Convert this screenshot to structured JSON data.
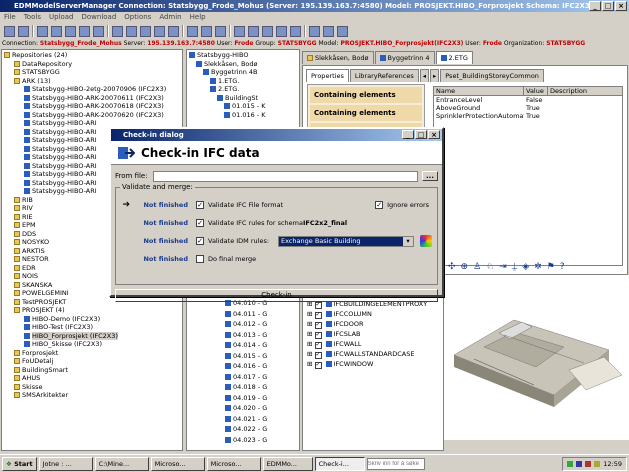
{
  "app": {
    "title": "EDMModelServerManager  Connection: Statsbygg_Frode_Mohus  (Server: 195.139.163.7:4580)  Model: PROSJEKT.HIBO_Forprosjekt  Schema: IFC2X3"
  },
  "menu": [
    "File",
    "Tools",
    "Upload",
    "Download",
    "Options",
    "Admin",
    "Help"
  ],
  "infobar": {
    "connection_label": "Connection:",
    "connection": "Statsbygg_Frode_Mohus",
    "server_label": "Server:",
    "server": "195.139.163.7:4580",
    "user_label": "User:",
    "user": "Frode",
    "group_label": "Group:",
    "group": "STATSBYGG",
    "model_label": "Model:",
    "model": "PROSJEKT.HIBO_Forprosjekt(IFC2X3)",
    "user2_label": "User:",
    "user2": "Frode",
    "org_label": "Organization:",
    "org": "STATSBYGG"
  },
  "left_tree": [
    "Repositories (24)",
    "DataRepository",
    "STATSBYGG",
    "ARK (13)",
    "Statsbygg-HIBO-2etg-20070906 (IFC2X3)",
    "Statsbygg-HIBO-ARK-20070611 (IFC2X3)",
    "Statsbygg-HIBO-ARK-20070618 (IFC2X3)",
    "Statsbygg-HIBO-ARK-20070620 (IFC2X3)",
    "Statsbygg-HIBO-ARI",
    "Statsbygg-HIBO-ARI",
    "Statsbygg-HIBO-ARI",
    "Statsbygg-HIBO-ARI",
    "Statsbygg-HIBO-ARI",
    "Statsbygg-HIBO-ARI",
    "Statsbygg-HIBO-ARI",
    "Statsbygg-HIBO-ARI",
    "Statsbygg-HIBO-ARI",
    "RIB",
    "RIV",
    "RIE",
    "EPM",
    "DDS",
    "NOSYKO",
    "ARKTIS",
    "NESTOR",
    "EDR",
    "NOIS",
    "SKANSKA",
    "POWELGEMINI",
    "TestPROSJEKT",
    "PROSJEKT (4)",
    "HIBO-Demo (IFC2X3)",
    "HIBO-Test (IFC2X3)",
    "HIBO_Forprosjekt (IFC2X3)",
    "HIBO_Skisse (IFC2X3)",
    "Forprosjekt",
    "FoUDetalj",
    "BuildingSmart",
    "AHUS",
    "Skisse",
    "SMSArkitekter"
  ],
  "mid_tree": {
    "top": [
      "Statsbygg-HIBO",
      "Slekkåsen, Bodø",
      "Byggetrinn 4B",
      "1.ETG.",
      "2.ETG.",
      "BuildingSt",
      "01.015 - K",
      "01.016 - K"
    ],
    "bottom": [
      "04.010 - G",
      "04.011 - G",
      "04.012 - G",
      "04.013 - G",
      "04.014 - G",
      "04.015 - G",
      "04.016 - G",
      "04.017 - G",
      "04.018 - G",
      "04.019 - G",
      "04.020 - G",
      "04.021 - G",
      "04.022 - G",
      "04.023 - G"
    ]
  },
  "right_tabs": [
    "Slekkåsen, Bodø",
    "Byggetrinn 4",
    "2.ETG"
  ],
  "sub_tabs": [
    "Properties",
    "LibraryReferences"
  ],
  "pset_tab": "Pset_BuildingStoreyCommon",
  "containing_label": "Containing elements",
  "prop_headers": [
    "Name",
    "Value",
    "Description"
  ],
  "props": [
    {
      "name": "EntranceLevel",
      "value": "False"
    },
    {
      "name": "AboveGround",
      "value": "True"
    },
    {
      "name": "SprinklerProtectionAutomatic",
      "value": "True"
    }
  ],
  "element_types": [
    "IFCBUILDINGELEMENTPROXY",
    "IFCCOLUMN",
    "IFCDOOR",
    "IFCSLAB",
    "IFCWALL",
    "IFCWALLSTANDARDCASE",
    "IFCWINDOW"
  ],
  "dialog": {
    "title": "Check-in dialog",
    "heading": "Check-in IFC data",
    "from_file_label": "From file:",
    "from_file_value": "",
    "browse": "...",
    "group_label": "Validate and merge:",
    "rows": [
      {
        "status": "Not finished",
        "label": "Validate IFC File format",
        "checked": true
      },
      {
        "status": "Not finished",
        "label_a": "Validate IFC rules for schema ",
        "label_b": "IFC2x2_final",
        "checked": true
      },
      {
        "status": "Not finished",
        "label": "Validate IDM rules:",
        "checked": true
      },
      {
        "status": "Not finished",
        "label": "Do final merge",
        "checked": false
      }
    ],
    "ignore_errors": "Ignore errors",
    "idm_select": "Exchange Basic Building",
    "checkin_button": "Check-in"
  },
  "taskbar": {
    "start": "Start",
    "items": [
      "Jotne : ...",
      "C:\\Mine...",
      "Microso...",
      "Microso...",
      "EDMMo...",
      "Check-i..."
    ],
    "search_placeholder": "Skriv inn for å søke",
    "clock": "12:59"
  }
}
